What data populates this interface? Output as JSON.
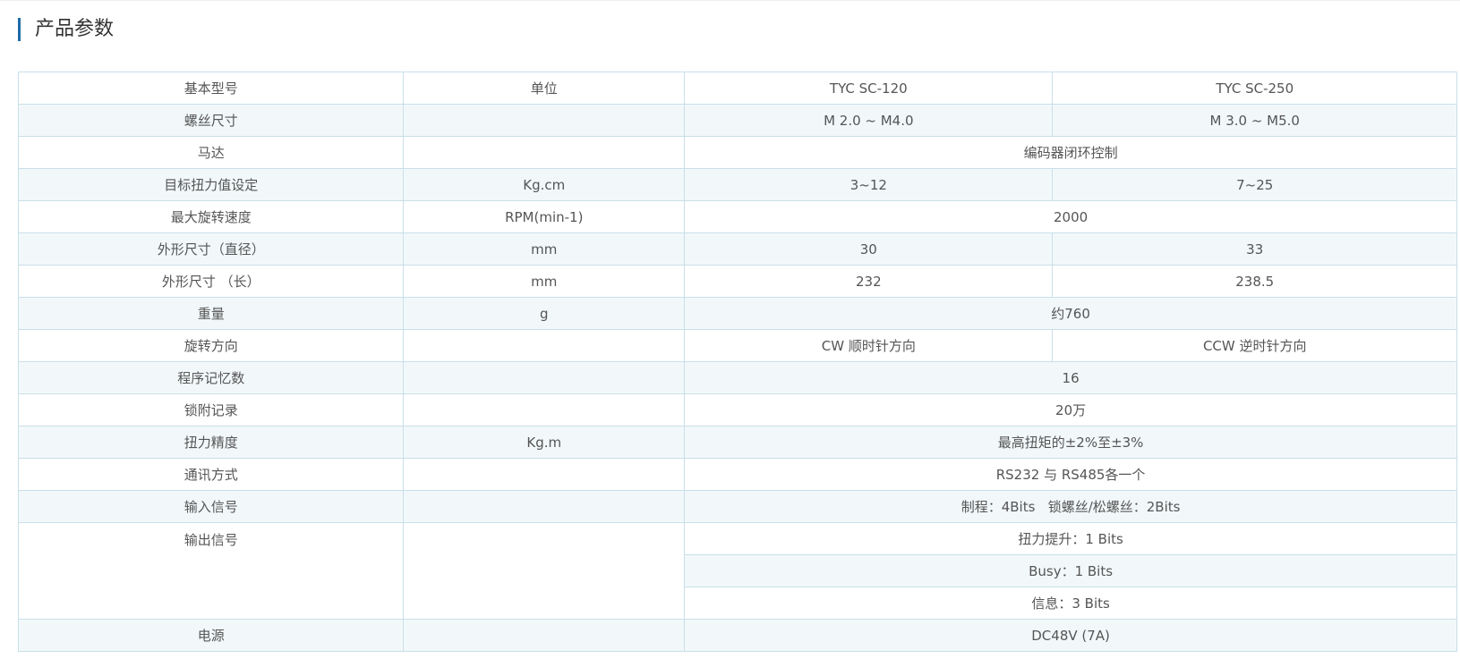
{
  "section_title": "产品参数",
  "header": {
    "name": "基本型号",
    "unit": "单位",
    "model_a": "TYC SC-120",
    "model_b": "TYC SC-250"
  },
  "rows": {
    "screw": {
      "name": "螺丝尺寸",
      "unit": "",
      "a": "M 2.0 ~ M4.0",
      "b": "M 3.0 ~ M5.0"
    },
    "motor": {
      "name": "马达",
      "unit": "",
      "value": "编码器闭环控制"
    },
    "torque_setting": {
      "name": "目标扭力值设定",
      "unit": "Kg.cm",
      "a": "3~12",
      "b": "7~25"
    },
    "max_speed": {
      "name": "最大旋转速度",
      "unit": "RPM(min-1)",
      "value": "2000"
    },
    "diameter": {
      "name": "外形尺寸（直径）",
      "unit": "mm",
      "a": "30",
      "b": "33"
    },
    "length": {
      "name": "外形尺寸 （长）",
      "unit": "mm",
      "a": "232",
      "b": "238.5"
    },
    "weight": {
      "name": "重量",
      "unit": "g",
      "value": "约760"
    },
    "rotation": {
      "name": "旋转方向",
      "unit": "",
      "a": "CW 顺时针方向",
      "b": "CCW 逆时针方向"
    },
    "programs": {
      "name": "程序记忆数",
      "unit": "",
      "value": "16"
    },
    "records": {
      "name": "锁附记录",
      "unit": "",
      "value": "20万"
    },
    "torque_accuracy": {
      "name": "扭力精度",
      "unit": "Kg.m",
      "value": "最高扭矩的±2%至±3%"
    },
    "comm": {
      "name": "通讯方式",
      "unit": "",
      "value": "RS232 与 RS485各一个"
    },
    "input": {
      "name": "输入信号",
      "unit": "",
      "value": "制程：4Bits   锁螺丝/松螺丝：2Bits"
    },
    "output": {
      "name": "输出信号",
      "unit": "",
      "values": [
        "扭力提升：1 Bits",
        "Busy：1 Bits",
        "信息：3 Bits"
      ]
    },
    "power": {
      "name": "电源",
      "unit": "",
      "value": "DC48V (7A)"
    }
  }
}
